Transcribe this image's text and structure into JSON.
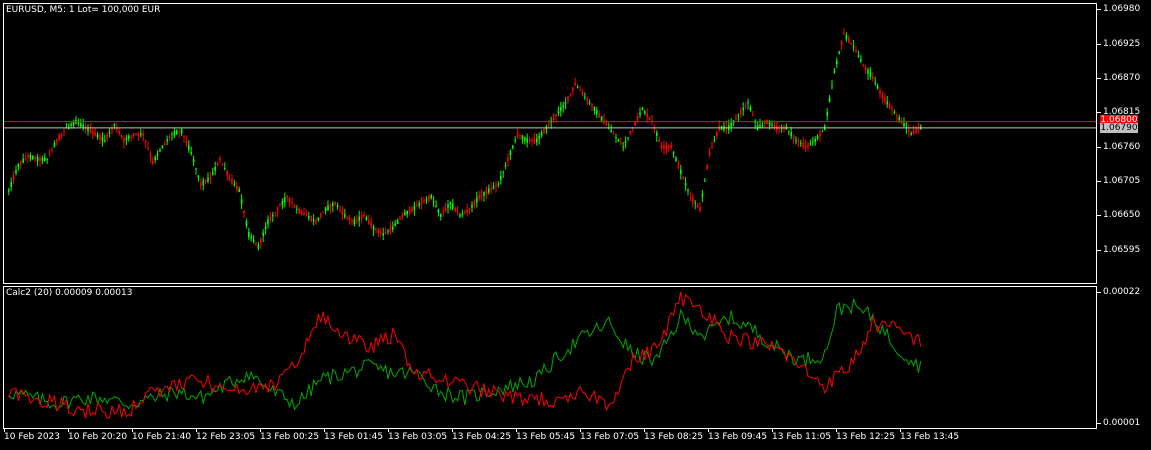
{
  "window": {
    "title": "EURUSD, M5:  1 Lot= 100,000 EUR",
    "symbol": "EURUSD",
    "timeframe": "M5"
  },
  "indicator": {
    "label": "Calc2 (20) 0.00009 0.00013",
    "name": "Calc2",
    "period": 20,
    "value1": "0.00009",
    "value2": "0.00013"
  },
  "colors": {
    "background": "#000000",
    "bull_candle": "#00ff00",
    "bear_candle": "#ff0000",
    "ask_line": "#ff0000",
    "bid_line": "#c0c0c0",
    "indicator_line_1": "#00aa00",
    "indicator_line_2": "#ff0000",
    "grid_frame": "#ffffff"
  },
  "price_axis": {
    "labels": [
      "1.06980",
      "1.06925",
      "1.06870",
      "1.06815",
      "1.06760",
      "1.06705",
      "1.06650",
      "1.06595"
    ],
    "ask_price": "1.06800",
    "bid_price": "1.06790"
  },
  "indicator_axis": {
    "labels": [
      "0.00022",
      "0.00001"
    ]
  },
  "time_axis": {
    "labels": [
      "10 Feb 2023",
      "10 Feb 20:20",
      "10 Feb 21:40",
      "12 Feb 23:05",
      "13 Feb 00:25",
      "13 Feb 01:45",
      "13 Feb 03:05",
      "13 Feb 04:25",
      "13 Feb 05:45",
      "13 Feb 07:05",
      "13 Feb 08:25",
      "13 Feb 09:45",
      "13 Feb 11:05",
      "13 Feb 12:25",
      "13 Feb 13:45"
    ]
  },
  "chart_data": {
    "type": "candlestick",
    "y_range": [
      1.0657,
      1.06985
    ],
    "indicator_range": [
      1e-05,
      0.00022
    ],
    "price_anchors": [
      [
        0,
        1.0669
      ],
      [
        4,
        1.0673
      ],
      [
        8,
        1.06745
      ],
      [
        12,
        1.0674
      ],
      [
        16,
        1.0674
      ],
      [
        20,
        1.0677
      ],
      [
        24,
        1.0679
      ],
      [
        28,
        1.068
      ],
      [
        32,
        1.0679
      ],
      [
        36,
        1.0678
      ],
      [
        40,
        1.0677
      ],
      [
        44,
        1.06795
      ],
      [
        48,
        1.0677
      ],
      [
        52,
        1.0678
      ],
      [
        56,
        1.0678
      ],
      [
        60,
        1.06735
      ],
      [
        64,
        1.0676
      ],
      [
        68,
        1.0678
      ],
      [
        72,
        1.06785
      ],
      [
        76,
        1.0675
      ],
      [
        80,
        1.067
      ],
      [
        84,
        1.0671
      ],
      [
        88,
        1.0674
      ],
      [
        92,
        1.0671
      ],
      [
        96,
        1.0669
      ],
      [
        100,
        1.0662
      ],
      [
        104,
        1.066
      ],
      [
        108,
        1.0664
      ],
      [
        112,
        1.0666
      ],
      [
        116,
        1.0668
      ],
      [
        120,
        1.0666
      ],
      [
        124,
        1.0665
      ],
      [
        128,
        1.0664
      ],
      [
        132,
        1.0666
      ],
      [
        136,
        1.0667
      ],
      [
        140,
        1.0665
      ],
      [
        144,
        1.0664
      ],
      [
        148,
        1.0665
      ],
      [
        152,
        1.0663
      ],
      [
        156,
        1.0662
      ],
      [
        160,
        1.0663
      ],
      [
        164,
        1.0665
      ],
      [
        168,
        1.0666
      ],
      [
        172,
        1.0667
      ],
      [
        176,
        1.0668
      ],
      [
        180,
        1.0665
      ],
      [
        184,
        1.0667
      ],
      [
        188,
        1.0665
      ],
      [
        192,
        1.0666
      ],
      [
        196,
        1.0668
      ],
      [
        200,
        1.0669
      ],
      [
        204,
        1.067
      ],
      [
        208,
        1.0674
      ],
      [
        212,
        1.0678
      ],
      [
        216,
        1.0677
      ],
      [
        220,
        1.0677
      ],
      [
        224,
        1.0679
      ],
      [
        228,
        1.0681
      ],
      [
        232,
        1.0683
      ],
      [
        236,
        1.0686
      ],
      [
        240,
        1.0684
      ],
      [
        244,
        1.0682
      ],
      [
        248,
        1.068
      ],
      [
        252,
        1.0678
      ],
      [
        256,
        1.0676
      ],
      [
        260,
        1.0679
      ],
      [
        264,
        1.0682
      ],
      [
        268,
        1.068
      ],
      [
        272,
        1.0676
      ],
      [
        276,
        1.0676
      ],
      [
        280,
        1.0672
      ],
      [
        284,
        1.0668
      ],
      [
        288,
        1.0666
      ],
      [
        292,
        1.0675
      ],
      [
        296,
        1.0679
      ],
      [
        300,
        1.0679
      ],
      [
        304,
        1.0681
      ],
      [
        308,
        1.0683
      ],
      [
        312,
        1.0679
      ],
      [
        316,
        1.068
      ],
      [
        320,
        1.0679
      ],
      [
        324,
        1.0679
      ],
      [
        328,
        1.0677
      ],
      [
        332,
        1.0676
      ],
      [
        336,
        1.0677
      ],
      [
        340,
        1.0679
      ],
      [
        344,
        1.0688
      ],
      [
        348,
        1.0694
      ],
      [
        352,
        1.0692
      ],
      [
        356,
        1.0689
      ],
      [
        360,
        1.0687
      ],
      [
        364,
        1.0684
      ],
      [
        368,
        1.0682
      ],
      [
        372,
        1.068
      ],
      [
        376,
        1.0678
      ],
      [
        380,
        1.0679
      ]
    ],
    "indicator_series": [
      {
        "name": "line-green",
        "color": "#00aa00",
        "anchors": [
          [
            0,
            6e-05
          ],
          [
            10,
            5e-05
          ],
          [
            20,
            4e-05
          ],
          [
            30,
            5e-05
          ],
          [
            40,
            5e-05
          ],
          [
            50,
            4e-05
          ],
          [
            60,
            5e-05
          ],
          [
            70,
            6e-05
          ],
          [
            80,
            5e-05
          ],
          [
            90,
            7e-05
          ],
          [
            100,
            9e-05
          ],
          [
            110,
            6e-05
          ],
          [
            120,
            4e-05
          ],
          [
            130,
            8e-05
          ],
          [
            140,
            9e-05
          ],
          [
            150,
            0.0001
          ],
          [
            160,
            9e-05
          ],
          [
            170,
            9e-05
          ],
          [
            180,
            6e-05
          ],
          [
            190,
            5e-05
          ],
          [
            200,
            6e-05
          ],
          [
            210,
            7e-05
          ],
          [
            220,
            8e-05
          ],
          [
            230,
            0.00012
          ],
          [
            240,
            0.00015
          ],
          [
            250,
            0.00017
          ],
          [
            260,
            0.00012
          ],
          [
            270,
            0.00011
          ],
          [
            280,
            0.00018
          ],
          [
            290,
            0.00015
          ],
          [
            300,
            0.00018
          ],
          [
            310,
            0.00016
          ],
          [
            320,
            0.00013
          ],
          [
            330,
            0.00011
          ],
          [
            340,
            0.00012
          ],
          [
            345,
            0.00019
          ],
          [
            350,
            0.0002
          ],
          [
            360,
            0.00018
          ],
          [
            370,
            0.00013
          ],
          [
            380,
            0.0001
          ]
        ]
      },
      {
        "name": "line-red",
        "color": "#ff0000",
        "anchors": [
          [
            0,
            6e-05
          ],
          [
            10,
            5e-05
          ],
          [
            20,
            4e-05
          ],
          [
            30,
            3e-05
          ],
          [
            40,
            3e-05
          ],
          [
            50,
            3e-05
          ],
          [
            60,
            6e-05
          ],
          [
            70,
            7e-05
          ],
          [
            80,
            8e-05
          ],
          [
            90,
            6e-05
          ],
          [
            100,
            6e-05
          ],
          [
            110,
            7e-05
          ],
          [
            120,
            0.00011
          ],
          [
            130,
            0.00018
          ],
          [
            140,
            0.00015
          ],
          [
            150,
            0.00013
          ],
          [
            160,
            0.00015
          ],
          [
            170,
            9e-05
          ],
          [
            180,
            8e-05
          ],
          [
            190,
            7e-05
          ],
          [
            200,
            6e-05
          ],
          [
            210,
            5e-05
          ],
          [
            220,
            5e-05
          ],
          [
            230,
            4e-05
          ],
          [
            240,
            6e-05
          ],
          [
            250,
            4e-05
          ],
          [
            260,
            0.00011
          ],
          [
            270,
            0.00013
          ],
          [
            280,
            0.00021
          ],
          [
            290,
            0.00019
          ],
          [
            300,
            0.00015
          ],
          [
            310,
            0.00014
          ],
          [
            320,
            0.00013
          ],
          [
            330,
            0.0001
          ],
          [
            340,
            7e-05
          ],
          [
            350,
            0.0001
          ],
          [
            355,
            0.00013
          ],
          [
            360,
            0.00017
          ],
          [
            370,
            0.00016
          ],
          [
            380,
            0.00014
          ]
        ]
      }
    ]
  }
}
